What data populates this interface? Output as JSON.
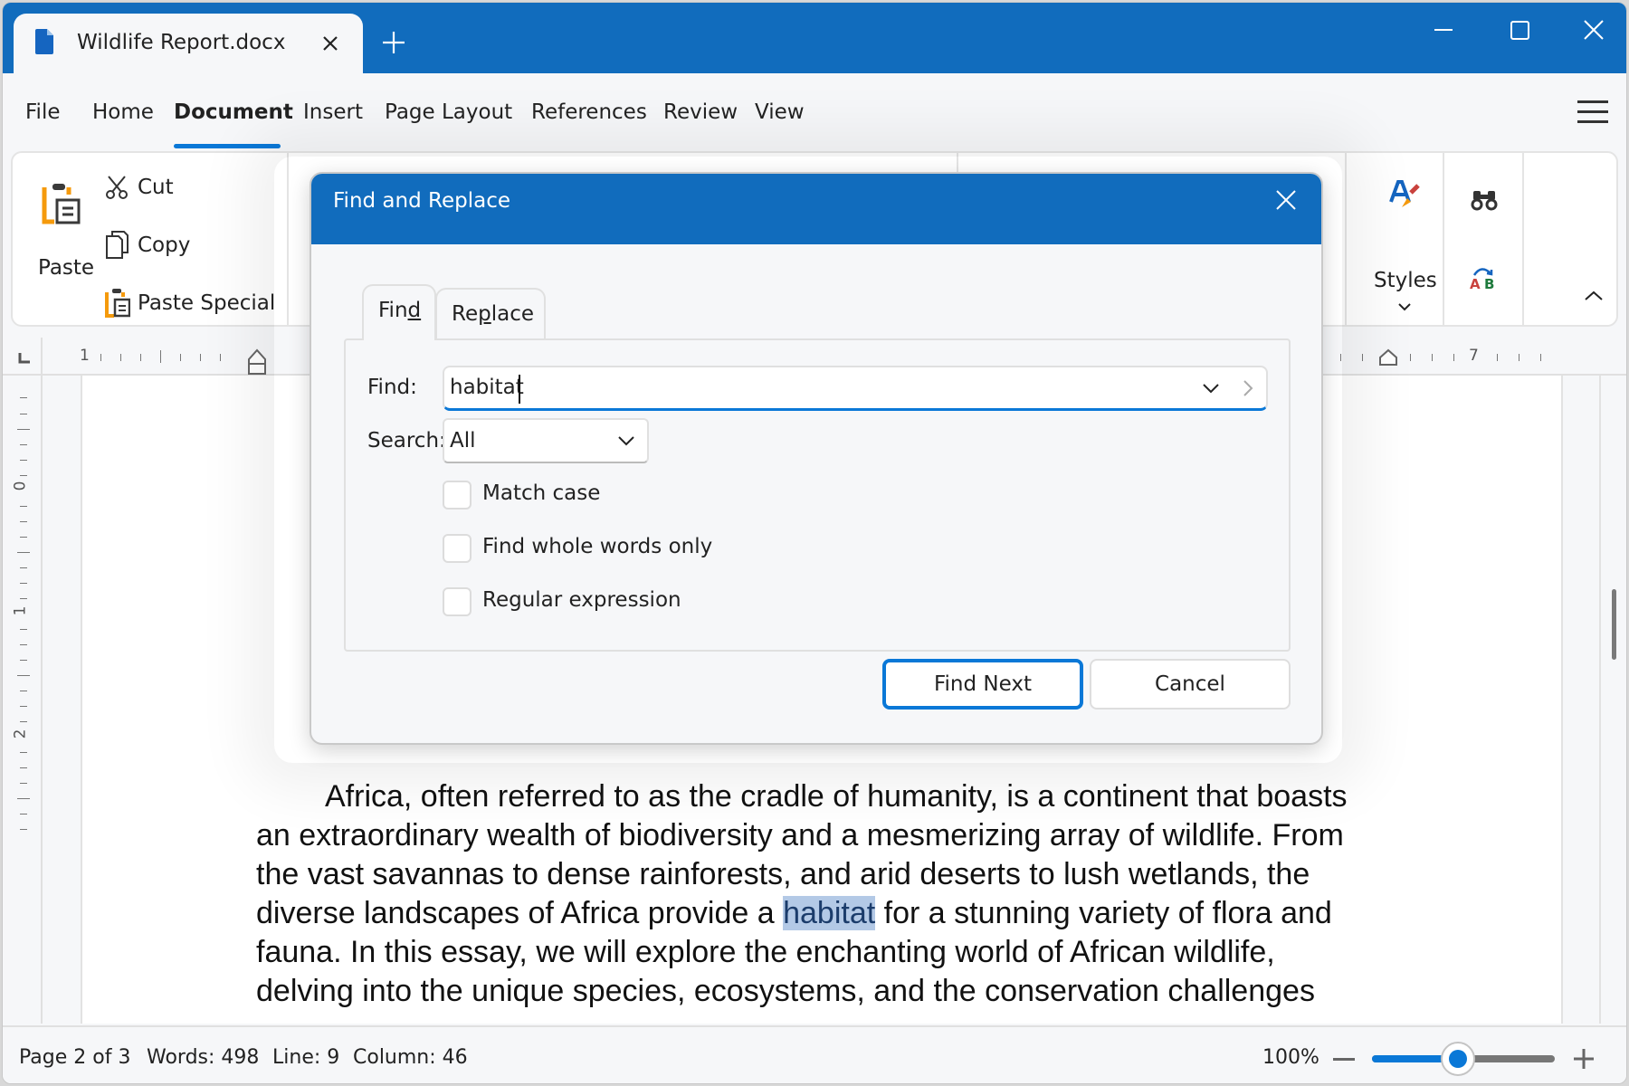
{
  "window": {
    "tab_title": "Wildlife Report.docx",
    "icons": [
      "file-icon",
      "close-icon",
      "plus-icon",
      "minimize-icon",
      "maximize-icon",
      "close-icon"
    ]
  },
  "menu": {
    "items": [
      "File",
      "Home",
      "Document",
      "Insert",
      "Page Layout",
      "References",
      "Review",
      "View"
    ],
    "active": "Document"
  },
  "ribbon": {
    "paste": "Paste",
    "cut": "Cut",
    "copy": "Copy",
    "paste_special": "Paste Special",
    "styles": "Styles"
  },
  "ruler": {
    "horizontal_labels": [
      "1",
      "7"
    ],
    "vertical_labels": [
      "0",
      "1",
      "2"
    ]
  },
  "document": {
    "lines": [
      "Africa, often referred to as the cradle of humanity, is a continent that boasts",
      "an extraordinary wealth of biodiversity and a mesmerizing array of wildlife. From",
      "the vast savannas to dense rainforests, and arid deserts to lush wetlands, the"
    ],
    "line4_before": "diverse landscapes of Africa provide a ",
    "line4_highlight": "habitat",
    "line4_after": " for a stunning variety of flora and",
    "lines_after": [
      "fauna. In this essay, we will explore the enchanting world of African wildlife,",
      "delving into the unique species, ecosystems, and the conservation challenges"
    ]
  },
  "dialog": {
    "title": "Find and Replace",
    "tabs": {
      "find_prefix": "Fin",
      "find_mnemonic": "d",
      "replace_prefix": "Re",
      "replace_mnemonic": "p",
      "replace_suffix": "lace"
    },
    "find_label": "Find:",
    "find_value": "habitat",
    "search_label": "Search:",
    "search_value": "All",
    "options": [
      {
        "label": "Match case",
        "checked": false
      },
      {
        "label": "Find whole words only",
        "checked": false
      },
      {
        "label": "Regular expression",
        "checked": false
      }
    ],
    "find_next": "Find Next",
    "cancel": "Cancel"
  },
  "status": {
    "page": "Page 2 of 3",
    "words": "Words: 498",
    "line": "Line: 9",
    "column": "Column: 46",
    "zoom": "100%",
    "zoom_slider_fraction": 0.47
  },
  "colors": {
    "accent": "#116cbd",
    "focus": "#0a78d7",
    "highlight": "#b3c9e6"
  }
}
